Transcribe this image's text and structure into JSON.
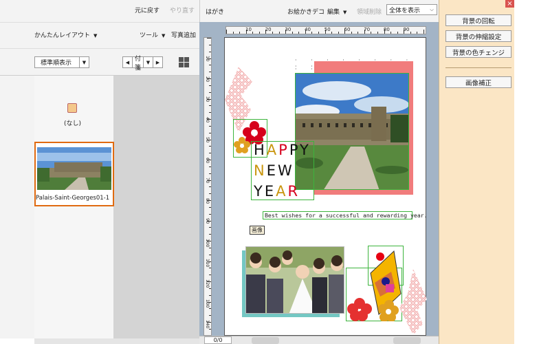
{
  "left_toolbar": {
    "undo": "元に戻す",
    "redo": "やり直す",
    "easy_layout": "かんたんレイアウト",
    "tools": "ツール",
    "add_photo": "写真追加",
    "sort_select": "標準順表示",
    "date_select": "付箋"
  },
  "thumbnails": {
    "none_label": "(なし)",
    "photo_caption": "Palais-Saint-Georges01-1"
  },
  "main_toolbar": {
    "card_type": "はがき",
    "picture_deco": "お絵かきデコ",
    "edit": "編集",
    "delete_area": "領域削除",
    "view_select": "全体を表示"
  },
  "ruler": {
    "h_labels": [
      "10",
      "20",
      "30",
      "40",
      "50",
      "60",
      "70",
      "80",
      "90"
    ],
    "v_labels": [
      "10",
      "20",
      "30",
      "40",
      "50",
      "60",
      "70",
      "80",
      "90",
      "100",
      "110",
      "120",
      "130",
      "140"
    ]
  },
  "card": {
    "hny_line1": [
      "H",
      "A",
      "P",
      "P",
      "Y"
    ],
    "hny_line2": [
      "N",
      "E",
      "W"
    ],
    "hny_line3": [
      "Y",
      "E",
      "A",
      "R"
    ],
    "greeting": "Best wishes for a successful and rewarding year.",
    "image_label": "画像"
  },
  "right_panel": {
    "rotate_bg": "背景の回転",
    "stretch_bg": "背景の伸縮設定",
    "color_change_bg": "背景の色チェンジ",
    "image_correct": "画像補正"
  },
  "bottom_bar": {
    "page_counter": "0/0"
  },
  "colors": {
    "accent_orange": "#e06a10",
    "panel_bg": "#fbe6c5",
    "canvas_bg": "#a3b4c6",
    "hny_gold": "#c9960f",
    "hny_red": "#d6001c"
  }
}
